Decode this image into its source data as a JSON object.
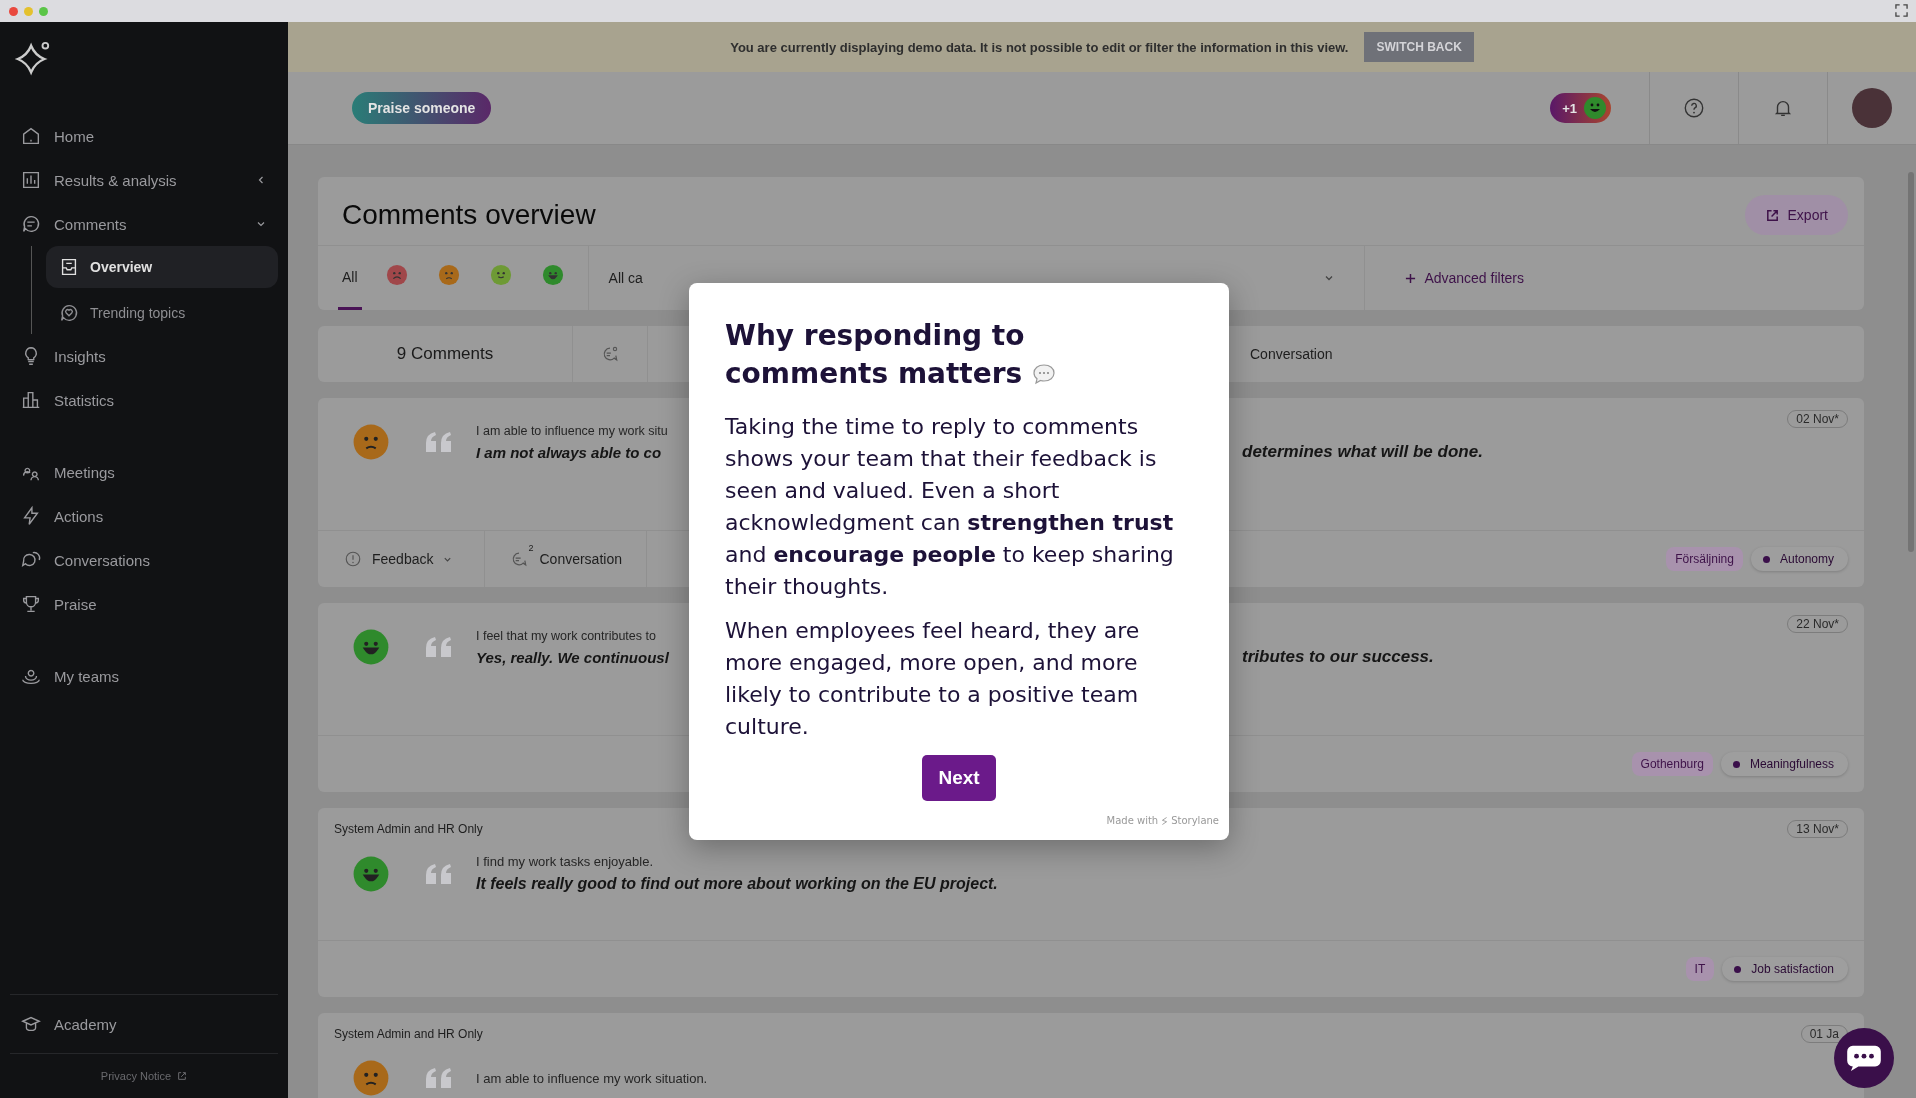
{
  "sidebar": {
    "groups": [
      {
        "items": [
          {
            "label": "Home",
            "selected": false
          },
          {
            "label": "Results & analysis",
            "selected": false,
            "expanded": false
          },
          {
            "label": "Comments",
            "selected": false,
            "expanded": true,
            "children": [
              {
                "label": "Overview",
                "selected": true
              },
              {
                "label": "Trending topics",
                "selected": false
              }
            ]
          },
          {
            "label": "Insights",
            "selected": false
          },
          {
            "label": "Statistics",
            "selected": false
          }
        ]
      },
      {
        "items": [
          {
            "label": "Meetings",
            "selected": false
          },
          {
            "label": "Actions",
            "selected": false
          },
          {
            "label": "Conversations",
            "selected": false
          },
          {
            "label": "Praise",
            "selected": false
          }
        ]
      },
      {
        "items": [
          {
            "label": "My teams",
            "selected": false
          }
        ]
      }
    ],
    "footer_items": [
      {
        "label": "Academy",
        "selected": false
      }
    ],
    "privacy_link": "Privacy Notice"
  },
  "demo_banner": {
    "text": "You are currently displaying demo data. It is not possible to edit or filter the information in this view.",
    "button": "SWITCH BACK"
  },
  "header": {
    "praise_button": "Praise someone",
    "praise_count": "+1"
  },
  "page": {
    "title": "Comments overview",
    "export_button": "Export"
  },
  "filters": {
    "tabs": [
      {
        "kind": "text",
        "label": "All",
        "selected": true
      },
      {
        "kind": "very_negative",
        "color": "#a0474a",
        "selected": false
      },
      {
        "kind": "negative",
        "color": "#a8691a",
        "selected": false
      },
      {
        "kind": "positive",
        "color": "#6e9a35",
        "selected": false
      },
      {
        "kind": "very_positive",
        "color": "#2f8a2c",
        "selected": false
      }
    ],
    "category_select": "All ca",
    "advanced_filters": "Advanced filters"
  },
  "summary": {
    "count": "9 Comments",
    "conversation": "Conversation"
  },
  "comments": [
    {
      "mood": {
        "kind": "negative",
        "color": "#a8691a"
      },
      "question": "I am able to influence my work situ",
      "comment_start": "I am not always able to co",
      "comment_end": "determines what will be done.",
      "date": "02 Nov*",
      "feedback": "Feedback",
      "conversation": {
        "label": "Conversation",
        "count": "2"
      },
      "tags": [
        {
          "kind": "group",
          "label": "Försäljning"
        },
        {
          "kind": "topic",
          "label": "Autonomy"
        }
      ]
    },
    {
      "mood": {
        "kind": "very_positive",
        "color": "#2f8a2c"
      },
      "question": "I feel that my work contributes to",
      "comment_start": "Yes, really. We continuousl",
      "comment_end": "tributes to our success.",
      "date": "22 Nov*",
      "tags": [
        {
          "kind": "group",
          "label": "Gothenburg"
        },
        {
          "kind": "topic",
          "label": "Meaningfulness"
        }
      ]
    },
    {
      "visibility": "System Admin and HR Only",
      "mood": {
        "kind": "very_positive",
        "color": "#2f8a2c"
      },
      "question": "I find my work tasks enjoyable.",
      "comment_start": "It feels really good to find out more about working on the EU project.",
      "date": "13 Nov*",
      "tags": [
        {
          "kind": "group",
          "label": "IT"
        },
        {
          "kind": "topic",
          "label": "Job satisfaction"
        }
      ]
    },
    {
      "visibility": "System Admin and HR Only",
      "mood": {
        "kind": "negative",
        "color": "#a8691a"
      },
      "question": "I am able to influence my work situation.",
      "date": "01 Ja"
    }
  ],
  "tour_modal": {
    "title": "Why responding to comments matters",
    "paragraphs": [
      "Taking the time to reply to comments shows your team that their feedback is seen and valued. Even a short acknowledgment can **strengthen trust** and **encourage people** to keep sharing their thoughts.",
      "When employees feel heard, they are more engaged, more open, and more likely to contribute to a positive team culture."
    ],
    "next_button": "Next",
    "credit_prefix": "Made with",
    "credit_brand": "Storylane"
  }
}
